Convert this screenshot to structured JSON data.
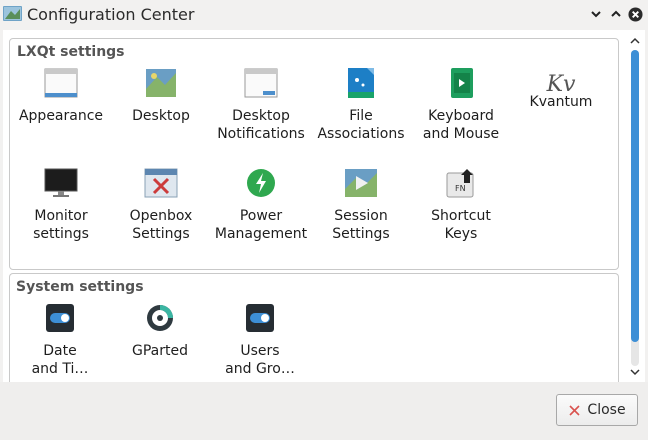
{
  "window": {
    "title": "Configuration Center"
  },
  "groups": {
    "lxqt": {
      "title": "LXQt settings",
      "items": [
        {
          "label": "Appearance",
          "icon": "appearance-icon"
        },
        {
          "label": "Desktop",
          "icon": "desktop-icon"
        },
        {
          "label": "Desktop\nNotifications",
          "icon": "desktop-notifications-icon"
        },
        {
          "label": "File\nAssociations",
          "icon": "file-associations-icon"
        },
        {
          "label": "Keyboard\nand Mouse",
          "icon": "keyboard-mouse-icon"
        },
        {
          "label": "Kvantum",
          "icon": "kvantum-icon"
        },
        {
          "label": "Monitor\nsettings",
          "icon": "monitor-icon"
        },
        {
          "label": "Openbox\nSettings",
          "icon": "openbox-icon"
        },
        {
          "label": "Power\nManagement",
          "icon": "power-icon"
        },
        {
          "label": "Session\nSettings",
          "icon": "session-icon"
        },
        {
          "label": "Shortcut\nKeys",
          "icon": "shortcut-keys-icon"
        }
      ]
    },
    "system": {
      "title": "System settings",
      "items": [
        {
          "label": "Date\nand Ti…",
          "icon": "date-time-icon"
        },
        {
          "label": "GParted",
          "icon": "gparted-icon"
        },
        {
          "label": "Users\nand Gro…",
          "icon": "users-groups-icon"
        }
      ]
    }
  },
  "footer": {
    "close_label": "Close"
  },
  "colors": {
    "accent": "#3d8fd6",
    "close_icon": "#d9534f"
  }
}
